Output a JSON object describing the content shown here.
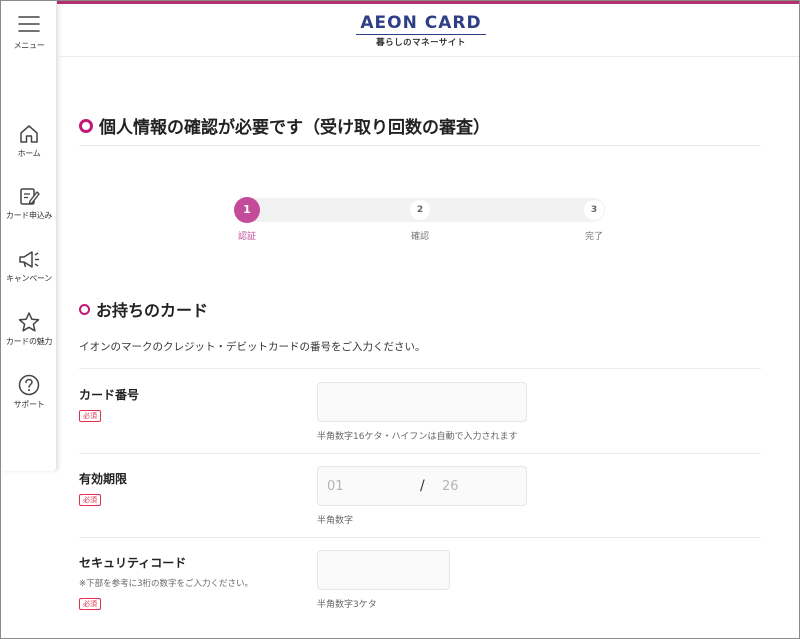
{
  "brand": {
    "name": "AEON CARD",
    "tagline": "暮らしのマネーサイト",
    "accent_color": "#c2187a",
    "step_color": "#c34b99",
    "logo_color": "#2e3f86"
  },
  "sidebar": {
    "menu_label": "メニュー",
    "items": [
      {
        "icon": "home-icon",
        "label": "ホーム"
      },
      {
        "icon": "card-apply-icon",
        "label": "カード申込み"
      },
      {
        "icon": "megaphone-icon",
        "label": "キャンペーン"
      },
      {
        "icon": "star-icon",
        "label": "カードの魅力"
      },
      {
        "icon": "help-icon",
        "label": "サポート"
      }
    ]
  },
  "page": {
    "title": "個人情報の確認が必要です（受け取り回数の審査）"
  },
  "stepper": {
    "steps": [
      {
        "number": "1",
        "label": "認証",
        "state": "active"
      },
      {
        "number": "2",
        "label": "確認",
        "state": "pending"
      },
      {
        "number": "3",
        "label": "完了",
        "state": "pending"
      }
    ]
  },
  "section": {
    "title": "お持ちのカード",
    "description": "イオンのマークのクレジット・デビットカードの番号をご入力ください。"
  },
  "fields": {
    "card_number": {
      "label": "カード番号",
      "badge": "必須",
      "value": "",
      "hint": "半角数字16ケタ・ハイフンは自動で入力されます"
    },
    "expiry": {
      "label": "有効期限",
      "badge": "必須",
      "month_placeholder": "01",
      "separator": "/",
      "year_placeholder": "26",
      "hint": "半角数字"
    },
    "security_code": {
      "label": "セキュリティコード",
      "note": "※下部を参考に3桁の数字をご入力ください。",
      "badge": "必須",
      "value": "",
      "hint": "半角数字3ケタ"
    }
  }
}
